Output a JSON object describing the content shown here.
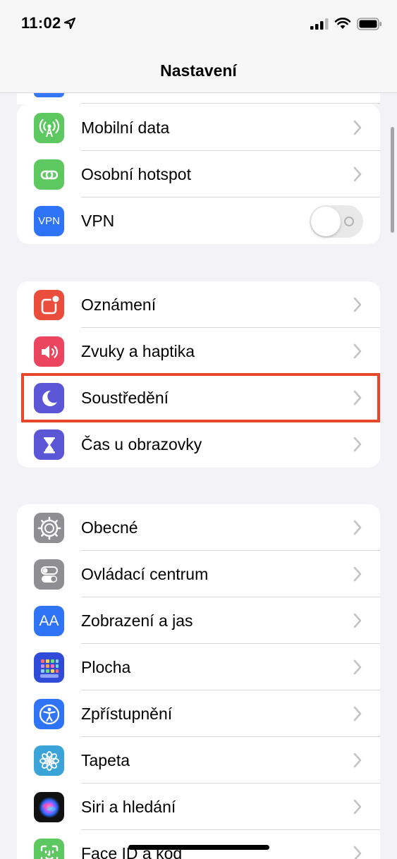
{
  "status": {
    "time": "11:02"
  },
  "nav": {
    "title": "Nastavení"
  },
  "groups": [
    {
      "items": [
        {
          "label": "Mobilní data",
          "icon": "antenna-icon",
          "color": "#5cc85f",
          "control": "chevron"
        },
        {
          "label": "Osobní hotspot",
          "icon": "hotspot-chain-icon",
          "color": "#5cc85f",
          "control": "chevron"
        },
        {
          "label": "VPN",
          "icon": "vpn-icon",
          "icon_text": "VPN",
          "color": "#2f74f6",
          "control": "toggle",
          "toggle_on": false
        }
      ]
    },
    {
      "items": [
        {
          "label": "Oznámení",
          "icon": "notifications-icon",
          "color": "#eb4d3d",
          "control": "chevron"
        },
        {
          "label": "Zvuky a haptika",
          "icon": "speaker-icon",
          "color": "#eb4560",
          "control": "chevron"
        },
        {
          "label": "Soustředění",
          "icon": "moon-icon",
          "color": "#5a56d6",
          "control": "chevron",
          "highlighted": true
        },
        {
          "label": "Čas u obrazovky",
          "icon": "hourglass-icon",
          "color": "#5a56d6",
          "control": "chevron"
        }
      ]
    },
    {
      "items": [
        {
          "label": "Obecné",
          "icon": "gear-icon",
          "color": "#8e8e93",
          "control": "chevron"
        },
        {
          "label": "Ovládací centrum",
          "icon": "switches-icon",
          "color": "#8e8e93",
          "control": "chevron"
        },
        {
          "label": "Zobrazení a jas",
          "icon": "text-size-icon",
          "icon_text": "AA",
          "color": "#2f74f6",
          "control": "chevron"
        },
        {
          "label": "Plocha",
          "icon": "home-screen-icon",
          "color": "#2f4bd8",
          "control": "chevron"
        },
        {
          "label": "Zpřístupnění",
          "icon": "accessibility-icon",
          "color": "#2f74f6",
          "control": "chevron"
        },
        {
          "label": "Tapeta",
          "icon": "flower-icon",
          "color": "#3aa4d9",
          "control": "chevron"
        },
        {
          "label": "Siri a hledání",
          "icon": "siri-icon",
          "color": "#111111",
          "control": "chevron"
        },
        {
          "label": "Face ID a kód",
          "icon": "face-id-icon",
          "color": "#5cc85f",
          "control": "chevron"
        }
      ]
    }
  ],
  "colors": {
    "highlight": "#e8472e",
    "background": "#f2f2f7",
    "chevron": "#c4c4c7"
  }
}
